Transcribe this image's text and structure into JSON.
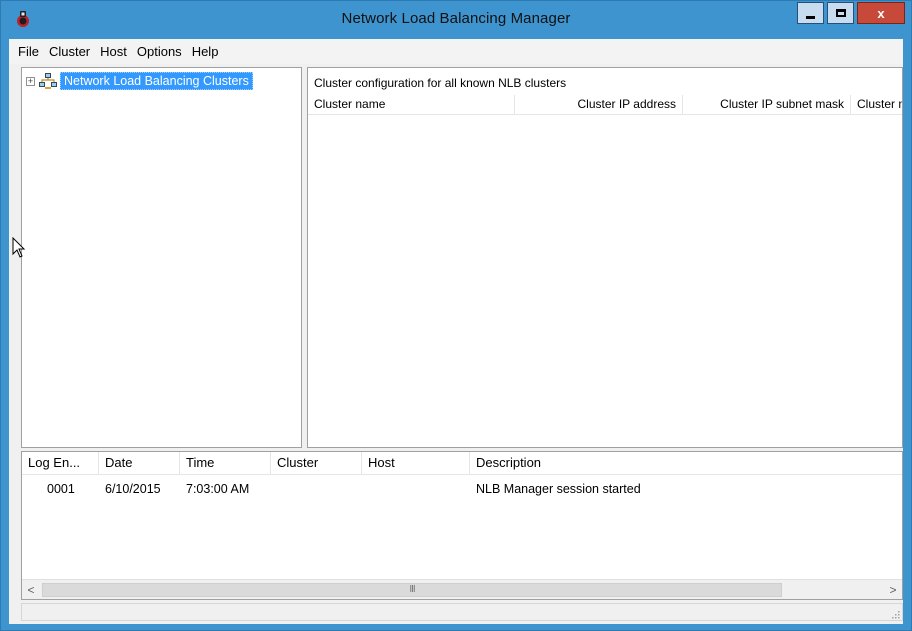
{
  "window": {
    "title": "Network Load Balancing Manager",
    "close_label": "x"
  },
  "menu": [
    "File",
    "Cluster",
    "Host",
    "Options",
    "Help"
  ],
  "tree": {
    "expander": "+",
    "root_label": "Network Load Balancing Clusters"
  },
  "cluster_list": {
    "caption": "Cluster configuration for all known NLB clusters",
    "columns": [
      "Cluster name",
      "Cluster IP address",
      "Cluster IP subnet mask",
      "Cluster mo"
    ]
  },
  "log": {
    "columns": [
      "Log En...",
      "Date",
      "Time",
      "Cluster",
      "Host",
      "Description"
    ],
    "rows": [
      {
        "entry": "0001",
        "date": "6/10/2015",
        "time": "7:03:00 AM",
        "cluster": "",
        "host": "",
        "description": "NLB Manager session started"
      }
    ],
    "scroll_left": "<",
    "scroll_right": ">",
    "thumb_grip": "III"
  },
  "colors": {
    "title_bar": "#3e94cf",
    "selection": "#3399ff",
    "close_button": "#c7493a"
  }
}
